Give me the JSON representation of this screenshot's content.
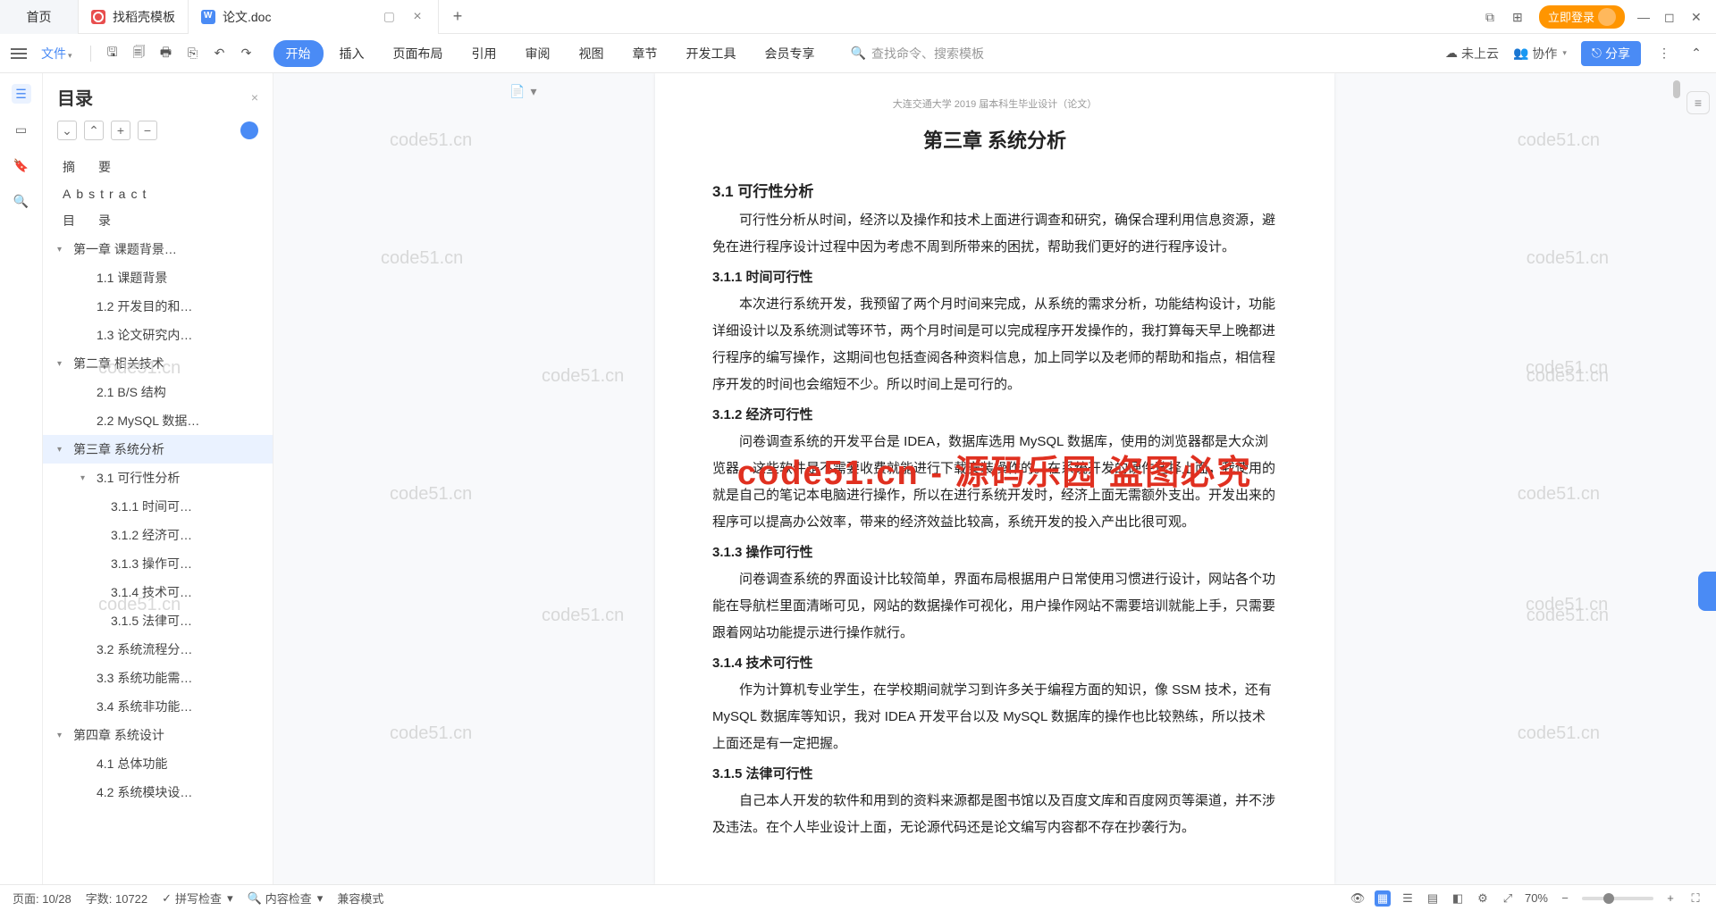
{
  "tabs": {
    "home": "首页",
    "t1": "找稻壳模板",
    "t2": "论文.doc",
    "login": "立即登录"
  },
  "menu": {
    "file": "文件",
    "items": [
      "开始",
      "插入",
      "页面布局",
      "引用",
      "审阅",
      "视图",
      "章节",
      "开发工具",
      "会员专享"
    ],
    "active_index": 0,
    "search_placeholder": "查找命令、搜索模板",
    "not_cloud": "未上云",
    "collab": "协作",
    "share": "分享"
  },
  "outline": {
    "title": "目录",
    "items": [
      {
        "label": "摘　要",
        "level": 0
      },
      {
        "label": "Abstract",
        "level": 0,
        "ls": false
      },
      {
        "label": "目　录",
        "level": 0
      },
      {
        "label": "第一章  课题背景…",
        "level": 1,
        "expandable": true,
        "expanded": true
      },
      {
        "label": "1.1 课题背景",
        "level": 2
      },
      {
        "label": "1.2 开发目的和…",
        "level": 2
      },
      {
        "label": "1.3 论文研究内…",
        "level": 2
      },
      {
        "label": "第二章  相关技术",
        "level": 1,
        "expandable": true,
        "expanded": true
      },
      {
        "label": "2.1 B/S 结构",
        "level": 2
      },
      {
        "label": "2.2 MySQL 数据…",
        "level": 2
      },
      {
        "label": "第三章  系统分析",
        "level": 1,
        "expandable": true,
        "expanded": true,
        "selected": true
      },
      {
        "label": "3.1 可行性分析",
        "level": 2,
        "expandable": true,
        "expanded": true
      },
      {
        "label": "3.1.1 时间可…",
        "level": 3
      },
      {
        "label": "3.1.2 经济可…",
        "level": 3
      },
      {
        "label": "3.1.3 操作可…",
        "level": 3
      },
      {
        "label": "3.1.4 技术可…",
        "level": 3
      },
      {
        "label": "3.1.5 法律可…",
        "level": 3
      },
      {
        "label": "3.2 系统流程分…",
        "level": 2
      },
      {
        "label": "3.3 系统功能需…",
        "level": 2
      },
      {
        "label": "3.4 系统非功能…",
        "level": 2
      },
      {
        "label": "第四章  系统设计",
        "level": 1,
        "expandable": true,
        "expanded": true
      },
      {
        "label": "4.1 总体功能",
        "level": 2
      },
      {
        "label": "4.2 系统模块设…",
        "level": 2
      }
    ]
  },
  "doc": {
    "header": "大连交通大学 2019 届本科生毕业设计（论文）",
    "chapter_title": "第三章  系统分析",
    "h3_1": "3.1 可行性分析",
    "p1": "可行性分析从时间，经济以及操作和技术上面进行调查和研究，确保合理利用信息资源，避免在进行程序设计过程中因为考虑不周到所带来的困扰，帮助我们更好的进行程序设计。",
    "h4_1": "3.1.1 时间可行性",
    "p2": "本次进行系统开发，我预留了两个月时间来完成，从系统的需求分析，功能结构设计，功能详细设计以及系统测试等环节，两个月时间是可以完成程序开发操作的，我打算每天早上晚都进行程序的编写操作，这期间也包括查阅各种资料信息，加上同学以及老师的帮助和指点，相信程序开发的时间也会缩短不少。所以时间上是可行的。",
    "h4_2": "3.1.2 经济可行性",
    "p3": "问卷调查系统的开发平台是 IDEA，数据库选用 MySQL 数据库，使用的浏览器都是大众浏览器，这些软件是不需要收费就能进行下载安装操作的。在系统开发的硬件选择上面，我使用的就是自己的笔记本电脑进行操作，所以在进行系统开发时，经济上面无需额外支出。开发出来的程序可以提高办公效率，带来的经济效益比较高，系统开发的投入产出比很可观。",
    "h4_3": "3.1.3 操作可行性",
    "p4": "问卷调查系统的界面设计比较简单，界面布局根据用户日常使用习惯进行设计，网站各个功能在导航栏里面清晰可见，网站的数据操作可视化，用户操作网站不需要培训就能上手，只需要跟着网站功能提示进行操作就行。",
    "h4_4": "3.1.4 技术可行性",
    "p5": "作为计算机专业学生，在学校期间就学习到许多关于编程方面的知识，像 SSM 技术，还有 MySQL 数据库等知识，我对 IDEA 开发平台以及 MySQL 数据库的操作也比较熟练，所以技术上面还是有一定把握。",
    "h4_5": "3.1.5 法律可行性",
    "p6": "自己本人开发的软件和用到的资料来源都是图书馆以及百度文库和百度网页等渠道，并不涉及违法。在个人毕业设计上面，无论源代码还是论文编写内容都不存在抄袭行为。"
  },
  "overlay": {
    "red": "code51.cn - 源码乐园 盗图必究",
    "wm": "code51.cn"
  },
  "status": {
    "page": "页面: 10/28",
    "words": "字数: 10722",
    "spell": "拼写检查",
    "content": "内容检查",
    "compat": "兼容模式",
    "zoom": "70%"
  }
}
